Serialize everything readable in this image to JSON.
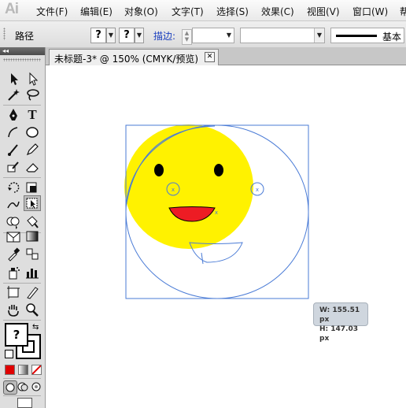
{
  "app": {
    "logo": "Ai"
  },
  "menu": {
    "items": [
      "文件(F)",
      "编辑(E)",
      "对象(O)",
      "文字(T)",
      "选择(S)",
      "效果(C)",
      "视图(V)",
      "窗口(W)",
      "帮"
    ]
  },
  "control_bar": {
    "selection_label": "路径",
    "fill_value": "?",
    "stroke_value": "?",
    "stroke_label": "描边:",
    "stroke_weight": "",
    "variable_width": "",
    "brush_label": "基本"
  },
  "document": {
    "tab_title": "未标题-3* @ 150% (CMYK/预览)"
  },
  "tools": {
    "fill_indicator": "?"
  },
  "tooltip": {
    "width": "W: 155.51 px",
    "height": "H: 147.03 px"
  },
  "colors": {
    "face_fill": "#fff200",
    "mouth_fill": "#ed1c24",
    "selection": "#4a7bd6",
    "panel_bg": "#dedede"
  }
}
